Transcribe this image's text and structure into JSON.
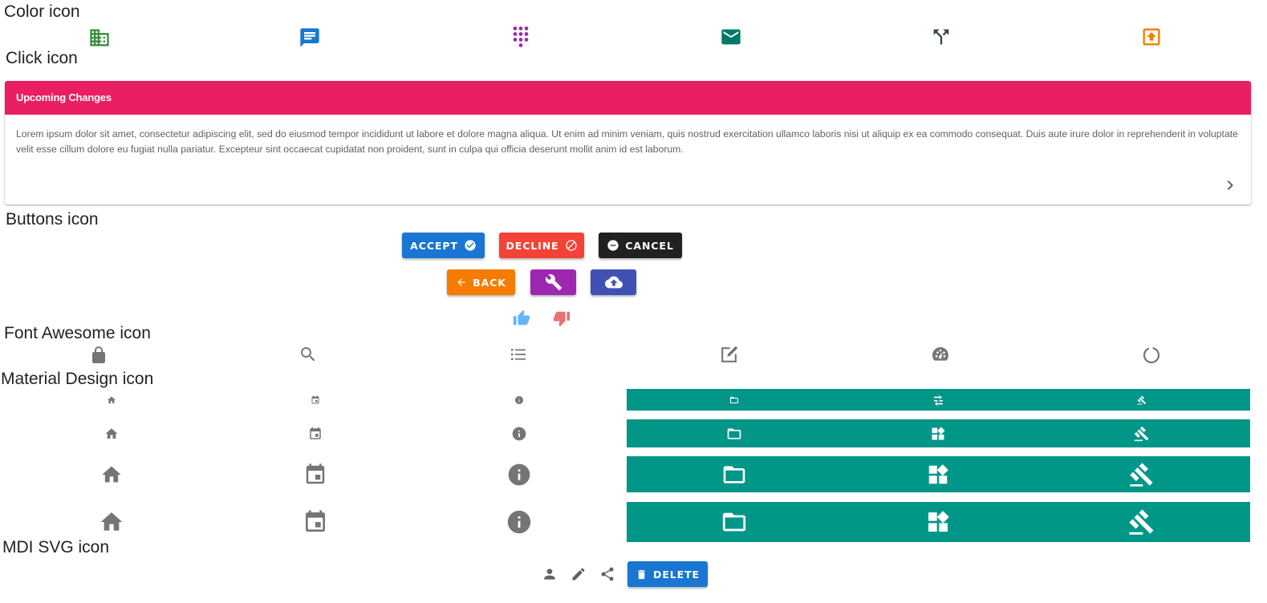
{
  "sections": {
    "color_icon": "Color icon",
    "click_icon": "Click icon",
    "buttons_icon": "Buttons icon",
    "font_awesome_icon": "Font Awesome icon",
    "material_design_icon": "Material Design icon",
    "mdi_svg_icon": "MDI SVG icon"
  },
  "color_icons": [
    {
      "name": "domain-icon",
      "color": "#388e3c"
    },
    {
      "name": "message-text-icon",
      "color": "#1976d2"
    },
    {
      "name": "dialpad-icon",
      "color": "#9c27b0"
    },
    {
      "name": "email-icon",
      "color": "#00796b"
    },
    {
      "name": "call-split-icon",
      "color": "#37474f"
    },
    {
      "name": "upload-box-icon",
      "color": "#f57c00"
    }
  ],
  "card": {
    "title": "Upcoming Changes",
    "body": "Lorem ipsum dolor sit amet, consectetur adipiscing elit, sed do eiusmod tempor incididunt ut labore et dolore magna aliqua. Ut enim ad minim veniam, quis nostrud exercitation ullamco laboris nisi ut aliquip ex ea commodo consequat. Duis aute irure dolor in reprehenderit in voluptate velit esse cillum dolore eu fugiat nulla pariatur. Excepteur sint occaecat cupidatat non proident, sunt in culpa qui officia deserunt mollit anim id est laborum.",
    "header_color": "#e91e63",
    "chevron_icon": "chevron-right-icon"
  },
  "buttons": {
    "accept": {
      "label": "Accept",
      "color": "#1976d2",
      "icon": "check-circle-icon"
    },
    "decline": {
      "label": "Decline",
      "color": "#f44336",
      "icon": "cancel-icon"
    },
    "cancel": {
      "label": "Cancel",
      "color": "#212121",
      "icon": "minus-circle-icon"
    },
    "back": {
      "label": "Back",
      "color": "#f57c00",
      "icon": "arrow-left-icon"
    },
    "wrench": {
      "color": "#9c27b0",
      "icon": "wrench-icon"
    },
    "upload": {
      "color": "#3f51b5",
      "icon": "cloud-upload-icon"
    },
    "thumb_up": {
      "color": "#64b5f6",
      "icon": "thumb-up-icon"
    },
    "thumb_down": {
      "color": "#e57373",
      "icon": "thumb-down-icon"
    }
  },
  "font_awesome_icons": [
    "lock-icon",
    "search-icon",
    "list-icon",
    "edit-icon",
    "tachometer-icon",
    "circle-notch-icon"
  ],
  "material_design": {
    "grey_icons": [
      "home-icon",
      "event-icon",
      "info-icon"
    ],
    "teal_icons": [
      "folder-open-icon",
      "widgets-icon",
      "gavel-icon"
    ],
    "teal_color": "#009688",
    "grey_color": "#757575"
  },
  "mdi_svg": {
    "icons": [
      "account-icon",
      "pencil-icon",
      "share-variant-icon"
    ],
    "delete_button": {
      "label": "Delete",
      "color": "#1976d2",
      "icon": "delete-icon"
    }
  }
}
